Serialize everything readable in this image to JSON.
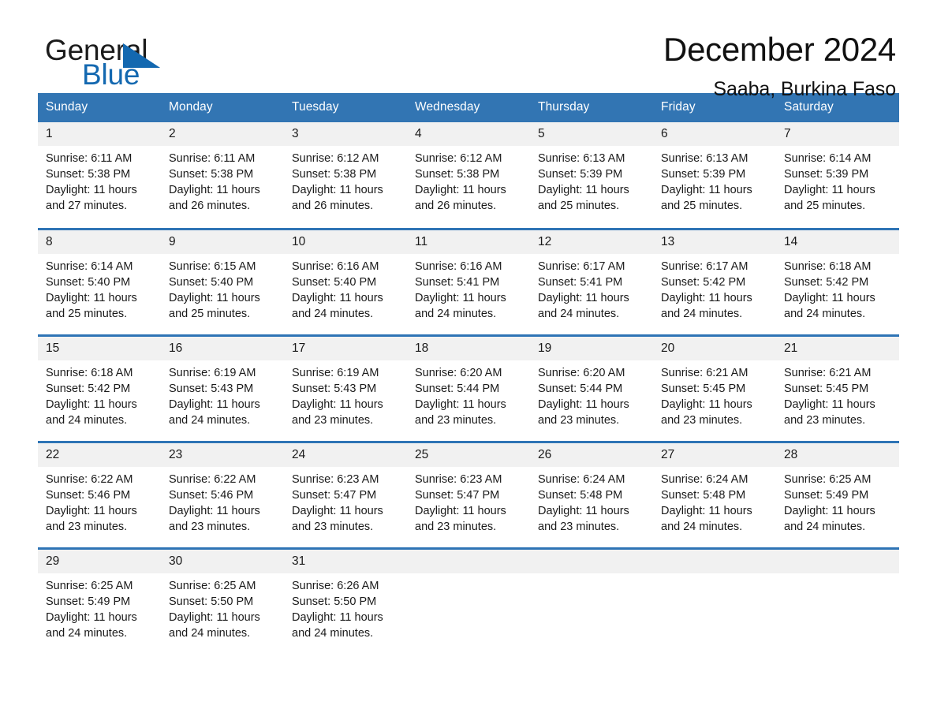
{
  "brand": {
    "name_part1": "General",
    "name_part2": "Blue",
    "triangle_color": "#1368b0"
  },
  "header": {
    "title": "December 2024",
    "subtitle": "Saaba, Burkina Faso"
  },
  "theme": {
    "header_blue": "#3275b3",
    "row_rule_blue": "#2e74b5",
    "daynum_band": "#f1f1f1",
    "text": "#1a1a1a"
  },
  "weekdays": [
    "Sunday",
    "Monday",
    "Tuesday",
    "Wednesday",
    "Thursday",
    "Friday",
    "Saturday"
  ],
  "weeks": [
    [
      {
        "day": "1",
        "sunrise": "Sunrise: 6:11 AM",
        "sunset": "Sunset: 5:38 PM",
        "daylight1": "Daylight: 11 hours",
        "daylight2": "and 27 minutes."
      },
      {
        "day": "2",
        "sunrise": "Sunrise: 6:11 AM",
        "sunset": "Sunset: 5:38 PM",
        "daylight1": "Daylight: 11 hours",
        "daylight2": "and 26 minutes."
      },
      {
        "day": "3",
        "sunrise": "Sunrise: 6:12 AM",
        "sunset": "Sunset: 5:38 PM",
        "daylight1": "Daylight: 11 hours",
        "daylight2": "and 26 minutes."
      },
      {
        "day": "4",
        "sunrise": "Sunrise: 6:12 AM",
        "sunset": "Sunset: 5:38 PM",
        "daylight1": "Daylight: 11 hours",
        "daylight2": "and 26 minutes."
      },
      {
        "day": "5",
        "sunrise": "Sunrise: 6:13 AM",
        "sunset": "Sunset: 5:39 PM",
        "daylight1": "Daylight: 11 hours",
        "daylight2": "and 25 minutes."
      },
      {
        "day": "6",
        "sunrise": "Sunrise: 6:13 AM",
        "sunset": "Sunset: 5:39 PM",
        "daylight1": "Daylight: 11 hours",
        "daylight2": "and 25 minutes."
      },
      {
        "day": "7",
        "sunrise": "Sunrise: 6:14 AM",
        "sunset": "Sunset: 5:39 PM",
        "daylight1": "Daylight: 11 hours",
        "daylight2": "and 25 minutes."
      }
    ],
    [
      {
        "day": "8",
        "sunrise": "Sunrise: 6:14 AM",
        "sunset": "Sunset: 5:40 PM",
        "daylight1": "Daylight: 11 hours",
        "daylight2": "and 25 minutes."
      },
      {
        "day": "9",
        "sunrise": "Sunrise: 6:15 AM",
        "sunset": "Sunset: 5:40 PM",
        "daylight1": "Daylight: 11 hours",
        "daylight2": "and 25 minutes."
      },
      {
        "day": "10",
        "sunrise": "Sunrise: 6:16 AM",
        "sunset": "Sunset: 5:40 PM",
        "daylight1": "Daylight: 11 hours",
        "daylight2": "and 24 minutes."
      },
      {
        "day": "11",
        "sunrise": "Sunrise: 6:16 AM",
        "sunset": "Sunset: 5:41 PM",
        "daylight1": "Daylight: 11 hours",
        "daylight2": "and 24 minutes."
      },
      {
        "day": "12",
        "sunrise": "Sunrise: 6:17 AM",
        "sunset": "Sunset: 5:41 PM",
        "daylight1": "Daylight: 11 hours",
        "daylight2": "and 24 minutes."
      },
      {
        "day": "13",
        "sunrise": "Sunrise: 6:17 AM",
        "sunset": "Sunset: 5:42 PM",
        "daylight1": "Daylight: 11 hours",
        "daylight2": "and 24 minutes."
      },
      {
        "day": "14",
        "sunrise": "Sunrise: 6:18 AM",
        "sunset": "Sunset: 5:42 PM",
        "daylight1": "Daylight: 11 hours",
        "daylight2": "and 24 minutes."
      }
    ],
    [
      {
        "day": "15",
        "sunrise": "Sunrise: 6:18 AM",
        "sunset": "Sunset: 5:42 PM",
        "daylight1": "Daylight: 11 hours",
        "daylight2": "and 24 minutes."
      },
      {
        "day": "16",
        "sunrise": "Sunrise: 6:19 AM",
        "sunset": "Sunset: 5:43 PM",
        "daylight1": "Daylight: 11 hours",
        "daylight2": "and 24 minutes."
      },
      {
        "day": "17",
        "sunrise": "Sunrise: 6:19 AM",
        "sunset": "Sunset: 5:43 PM",
        "daylight1": "Daylight: 11 hours",
        "daylight2": "and 23 minutes."
      },
      {
        "day": "18",
        "sunrise": "Sunrise: 6:20 AM",
        "sunset": "Sunset: 5:44 PM",
        "daylight1": "Daylight: 11 hours",
        "daylight2": "and 23 minutes."
      },
      {
        "day": "19",
        "sunrise": "Sunrise: 6:20 AM",
        "sunset": "Sunset: 5:44 PM",
        "daylight1": "Daylight: 11 hours",
        "daylight2": "and 23 minutes."
      },
      {
        "day": "20",
        "sunrise": "Sunrise: 6:21 AM",
        "sunset": "Sunset: 5:45 PM",
        "daylight1": "Daylight: 11 hours",
        "daylight2": "and 23 minutes."
      },
      {
        "day": "21",
        "sunrise": "Sunrise: 6:21 AM",
        "sunset": "Sunset: 5:45 PM",
        "daylight1": "Daylight: 11 hours",
        "daylight2": "and 23 minutes."
      }
    ],
    [
      {
        "day": "22",
        "sunrise": "Sunrise: 6:22 AM",
        "sunset": "Sunset: 5:46 PM",
        "daylight1": "Daylight: 11 hours",
        "daylight2": "and 23 minutes."
      },
      {
        "day": "23",
        "sunrise": "Sunrise: 6:22 AM",
        "sunset": "Sunset: 5:46 PM",
        "daylight1": "Daylight: 11 hours",
        "daylight2": "and 23 minutes."
      },
      {
        "day": "24",
        "sunrise": "Sunrise: 6:23 AM",
        "sunset": "Sunset: 5:47 PM",
        "daylight1": "Daylight: 11 hours",
        "daylight2": "and 23 minutes."
      },
      {
        "day": "25",
        "sunrise": "Sunrise: 6:23 AM",
        "sunset": "Sunset: 5:47 PM",
        "daylight1": "Daylight: 11 hours",
        "daylight2": "and 23 minutes."
      },
      {
        "day": "26",
        "sunrise": "Sunrise: 6:24 AM",
        "sunset": "Sunset: 5:48 PM",
        "daylight1": "Daylight: 11 hours",
        "daylight2": "and 23 minutes."
      },
      {
        "day": "27",
        "sunrise": "Sunrise: 6:24 AM",
        "sunset": "Sunset: 5:48 PM",
        "daylight1": "Daylight: 11 hours",
        "daylight2": "and 24 minutes."
      },
      {
        "day": "28",
        "sunrise": "Sunrise: 6:25 AM",
        "sunset": "Sunset: 5:49 PM",
        "daylight1": "Daylight: 11 hours",
        "daylight2": "and 24 minutes."
      }
    ],
    [
      {
        "day": "29",
        "sunrise": "Sunrise: 6:25 AM",
        "sunset": "Sunset: 5:49 PM",
        "daylight1": "Daylight: 11 hours",
        "daylight2": "and 24 minutes."
      },
      {
        "day": "30",
        "sunrise": "Sunrise: 6:25 AM",
        "sunset": "Sunset: 5:50 PM",
        "daylight1": "Daylight: 11 hours",
        "daylight2": "and 24 minutes."
      },
      {
        "day": "31",
        "sunrise": "Sunrise: 6:26 AM",
        "sunset": "Sunset: 5:50 PM",
        "daylight1": "Daylight: 11 hours",
        "daylight2": "and 24 minutes."
      },
      {
        "day": "",
        "sunrise": "",
        "sunset": "",
        "daylight1": "",
        "daylight2": ""
      },
      {
        "day": "",
        "sunrise": "",
        "sunset": "",
        "daylight1": "",
        "daylight2": ""
      },
      {
        "day": "",
        "sunrise": "",
        "sunset": "",
        "daylight1": "",
        "daylight2": ""
      },
      {
        "day": "",
        "sunrise": "",
        "sunset": "",
        "daylight1": "",
        "daylight2": ""
      }
    ]
  ]
}
